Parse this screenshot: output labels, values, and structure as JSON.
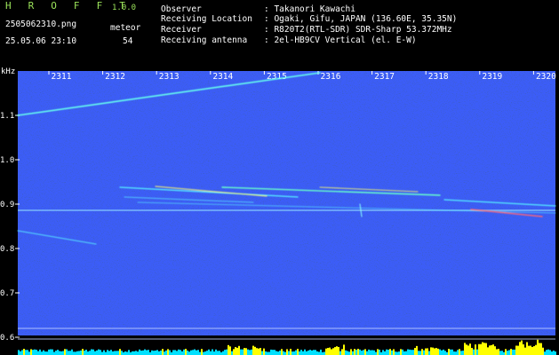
{
  "app": {
    "name": "H R O F F T",
    "version": "1.0.0"
  },
  "file": {
    "name": "2505062310.png",
    "datetime": "25.05.06 23:10"
  },
  "meteor": {
    "label": "meteor",
    "count": "54"
  },
  "info": [
    {
      "label": "Observer",
      "value": ": Takanori Kawachi"
    },
    {
      "label": "Receiving Location",
      "value": ": Ogaki, Gifu, JAPAN (136.60E, 35.35N)"
    },
    {
      "label": "Receiver",
      "value": ": R820T2(RTL-SDR) SDR-Sharp 53.372MHz"
    },
    {
      "label": "Receiving antenna",
      "value": ": 2el-HB9CV Vertical (el. E-W)"
    }
  ],
  "axis": {
    "y_unit": "kHz",
    "y_ticks": [
      "1.1",
      "1.0",
      "0.9",
      "0.8",
      "0.7",
      "0.6"
    ],
    "x_ticks": [
      "2311",
      "2312",
      "2313",
      "2314",
      "2315",
      "2316",
      "2317",
      "2318",
      "2319",
      "2320"
    ]
  },
  "colors": {
    "background": "#000000",
    "noise": "#0a1a9a",
    "trace": "#66ffee",
    "header_text": "#ffffff",
    "logo": "#9be35a",
    "level": "#ffff00"
  }
}
